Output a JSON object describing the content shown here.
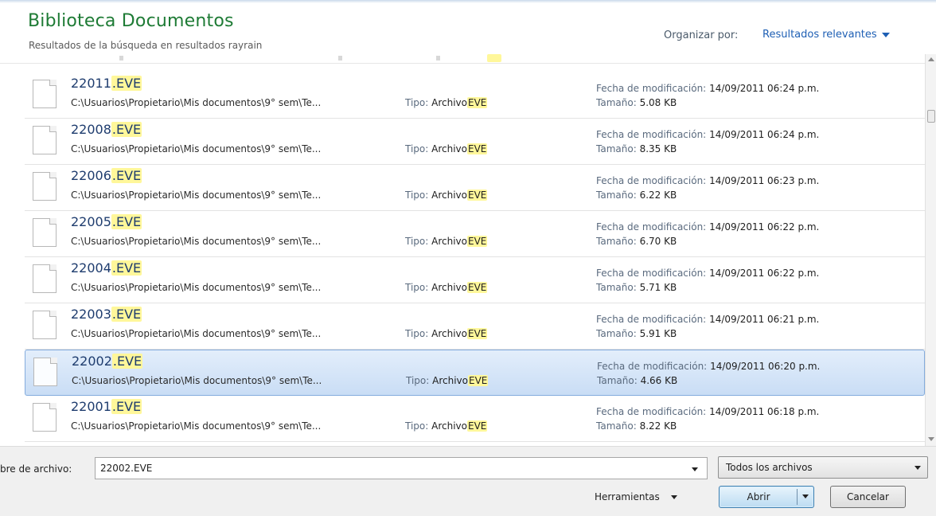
{
  "header": {
    "title": "Biblioteca Documentos",
    "subtitle": "Resultados de la búsqueda en resultados rayrain",
    "arrange_label": "Organizar por:",
    "arrange_value": "Resultados relevantes"
  },
  "labels": {
    "type": "Tipo:",
    "modified": "Fecha de modificación:",
    "size": "Tamaño:"
  },
  "files": [
    {
      "base": "22011",
      "ext": ".EVE",
      "path": "C:\\Usuarios\\Propietario\\Mis documentos\\9° sem\\Te...",
      "type_prefix": "Archivo",
      "type_ext": "EVE",
      "modified": "14/09/2011 06:24 p.m.",
      "size": "5.08 KB",
      "selected": false
    },
    {
      "base": "22008",
      "ext": ".EVE",
      "path": "C:\\Usuarios\\Propietario\\Mis documentos\\9° sem\\Te...",
      "type_prefix": "Archivo",
      "type_ext": "EVE",
      "modified": "14/09/2011 06:24 p.m.",
      "size": "8.35 KB",
      "selected": false
    },
    {
      "base": "22006",
      "ext": ".EVE",
      "path": "C:\\Usuarios\\Propietario\\Mis documentos\\9° sem\\Te...",
      "type_prefix": "Archivo",
      "type_ext": "EVE",
      "modified": "14/09/2011 06:23 p.m.",
      "size": "6.22 KB",
      "selected": false
    },
    {
      "base": "22005",
      "ext": ".EVE",
      "path": "C:\\Usuarios\\Propietario\\Mis documentos\\9° sem\\Te...",
      "type_prefix": "Archivo",
      "type_ext": "EVE",
      "modified": "14/09/2011 06:22 p.m.",
      "size": "6.70 KB",
      "selected": false
    },
    {
      "base": "22004",
      "ext": ".EVE",
      "path": "C:\\Usuarios\\Propietario\\Mis documentos\\9° sem\\Te...",
      "type_prefix": "Archivo",
      "type_ext": "EVE",
      "modified": "14/09/2011 06:22 p.m.",
      "size": "5.71 KB",
      "selected": false
    },
    {
      "base": "22003",
      "ext": ".EVE",
      "path": "C:\\Usuarios\\Propietario\\Mis documentos\\9° sem\\Te...",
      "type_prefix": "Archivo",
      "type_ext": "EVE",
      "modified": "14/09/2011 06:21 p.m.",
      "size": "5.91 KB",
      "selected": false
    },
    {
      "base": "22002",
      "ext": ".EVE",
      "path": "C:\\Usuarios\\Propietario\\Mis documentos\\9° sem\\Te...",
      "type_prefix": "Archivo",
      "type_ext": "EVE",
      "modified": "14/09/2011 06:20 p.m.",
      "size": "4.66 KB",
      "selected": true
    },
    {
      "base": "22001",
      "ext": ".EVE",
      "path": "C:\\Usuarios\\Propietario\\Mis documentos\\9° sem\\Te...",
      "type_prefix": "Archivo",
      "type_ext": "EVE",
      "modified": "14/09/2011 06:18 p.m.",
      "size": "8.22 KB",
      "selected": false
    }
  ],
  "footer": {
    "filename_label": "bre de archivo:",
    "filename_value": "22002.EVE",
    "filter_value": "Todos los archivos",
    "tools_label": "Herramientas",
    "open_label": "Abrir",
    "cancel_label": "Cancelar"
  },
  "colors": {
    "title_green": "#1e7b35",
    "link_blue": "#1e5fb4",
    "highlight_yellow": "#fff79a",
    "selection_border": "#84acdd"
  },
  "icons": {
    "file": "file-icon",
    "dropdown": "chevron-down-icon"
  }
}
